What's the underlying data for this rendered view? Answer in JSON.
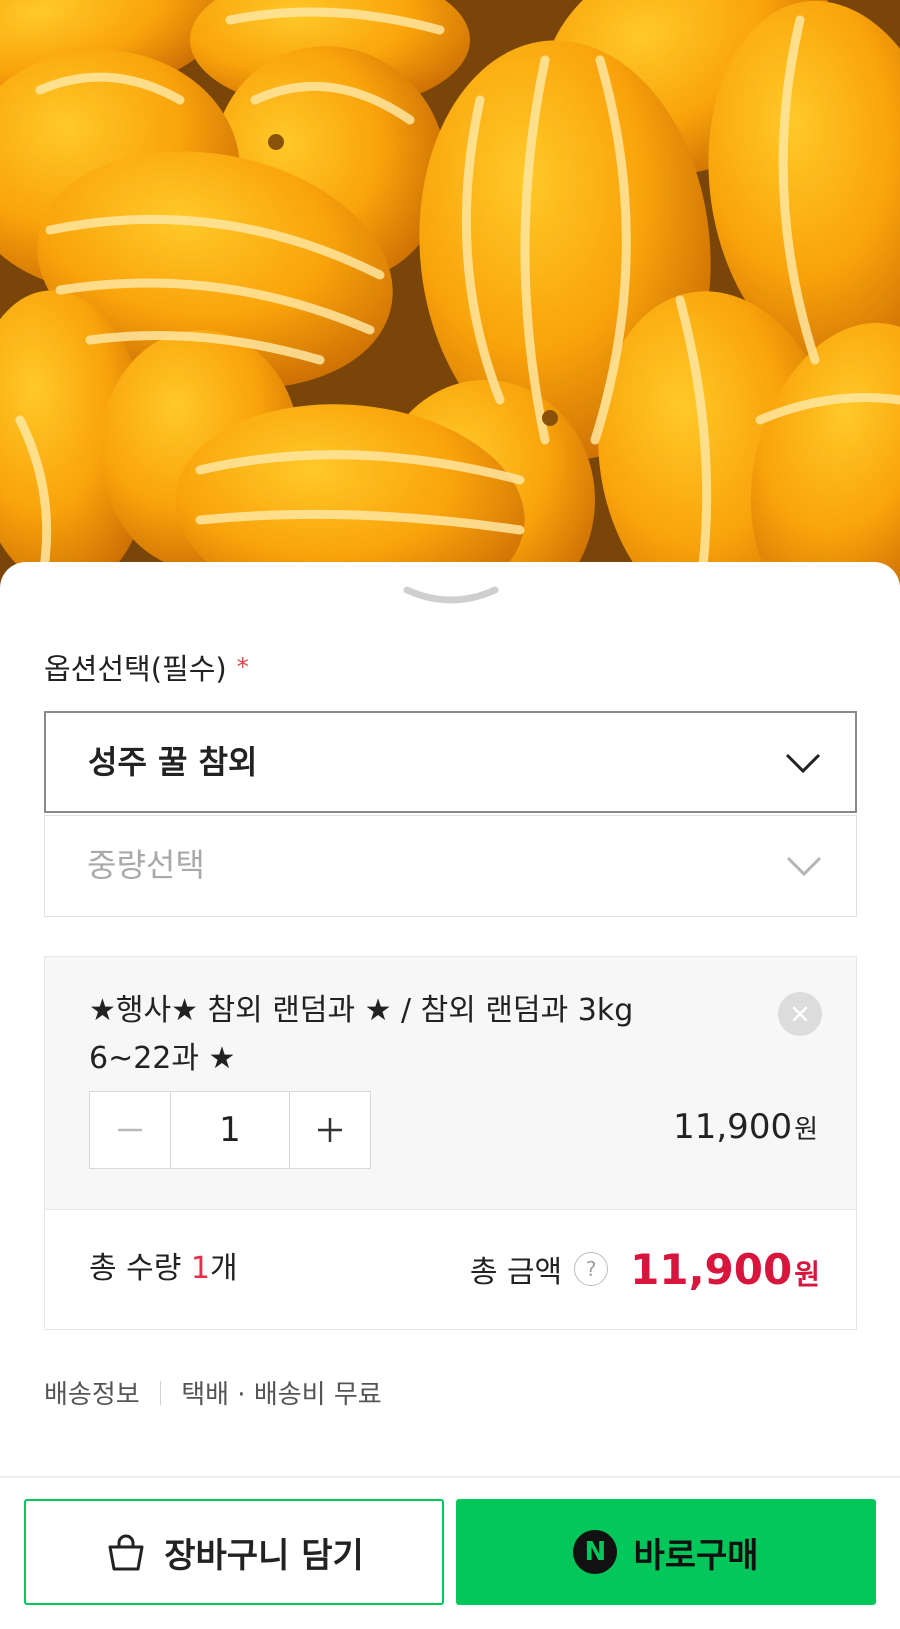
{
  "product_image": {
    "alt": "yellow korean melons",
    "icon": "product-photo"
  },
  "option_section": {
    "title": "옵션선택(필수)",
    "required_mark": "*",
    "select_1": {
      "value": "성주 꿀 참외",
      "icon": "chevron-down-icon"
    },
    "select_2": {
      "placeholder": "중량선택",
      "icon": "chevron-down-icon"
    }
  },
  "selected_item": {
    "name": "★행사★ 참외 랜덤과 ★ / 참외 랜덤과 3kg 6~22과 ★",
    "quantity": "1",
    "minus_symbol": "−",
    "plus_symbol": "+",
    "price": "11,900",
    "currency": "원",
    "remove_icon": "close-icon"
  },
  "totals": {
    "qty_label": "총 수량",
    "qty_value": "1",
    "qty_unit": "개",
    "amount_label": "총 금액",
    "help_symbol": "?",
    "amount_value": "11,900",
    "currency": "원"
  },
  "shipping": {
    "label": "배송정보",
    "value": "택배 · 배송비 무료"
  },
  "buttons": {
    "cart_label": "장바구니 담기",
    "buy_label": "바로구매",
    "buy_badge": "N"
  },
  "colors": {
    "accent_green": "#03c75a",
    "price_red": "#d8153d",
    "required_red": "#e3414b"
  }
}
